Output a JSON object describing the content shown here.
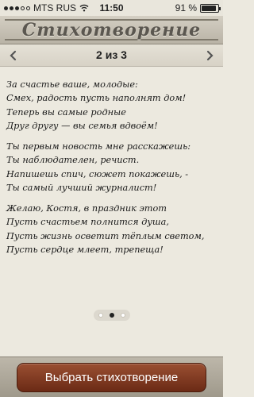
{
  "status_bar": {
    "carrier": "MTS RUS",
    "time": "11:50",
    "battery": "91 %",
    "battery_level": 0.91
  },
  "title_bar": {
    "title": "Стихотворение"
  },
  "pager": {
    "label": "2 из 3",
    "prev_icon": "chevron-left-icon",
    "next_icon": "chevron-right-icon"
  },
  "poem": {
    "stanzas": [
      [
        "За счастье ваше, молодые:",
        "Смех, радость пусть наполнят дом!",
        "Теперь вы самые родные",
        "Друг другу — вы семья вдвоём!"
      ],
      [
        "Ты первым новость мне расскажешь:",
        "Ты наблюдателен, речист.",
        "Напишешь спич, сюжет покажешь, -",
        "Ты самый лучший журналист!"
      ],
      [
        "Желаю, Костя, в праздник этот",
        "Пусть счастьем полнится душа,",
        "Пусть жизнь осветит тёплым светом,",
        "Пусть сердце млеет, трепеща!"
      ]
    ]
  },
  "page_indicator": {
    "count": 3,
    "active": 2
  },
  "bottom": {
    "select_label": "Выбрать стихотворение"
  },
  "colors": {
    "background": "#ece9df",
    "button": "#7d3820",
    "title_text": "#5b5750"
  }
}
